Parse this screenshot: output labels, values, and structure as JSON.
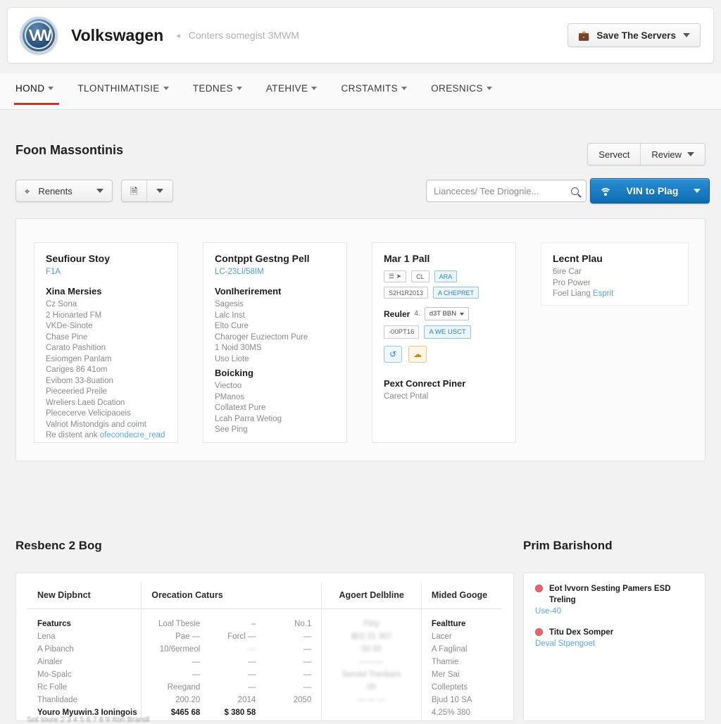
{
  "header": {
    "logo_alt": "vw-logo",
    "brand": "Volkswagen",
    "caret": "◂",
    "subtitle": "Conters somegist 3MWM",
    "save_button": {
      "label": "Save The Servers",
      "icon": "briefcase-icon"
    }
  },
  "nav": {
    "items": [
      {
        "label": "HOND",
        "active": true
      },
      {
        "label": "TLONTHIMATISIE",
        "active": false
      },
      {
        "label": "TEDNES",
        "active": false
      },
      {
        "label": "ATEHIVE",
        "active": false
      },
      {
        "label": "CRSTAMITS",
        "active": false
      },
      {
        "label": "ORESNICS",
        "active": false
      }
    ]
  },
  "section": {
    "title": "Foon Massontinis",
    "segmented": [
      {
        "label": "Servect"
      },
      {
        "label": "Review"
      }
    ]
  },
  "toolbar": {
    "renents_button": {
      "label": "Renents",
      "icon": "filter-icon"
    },
    "view_split": {
      "icon": "book-icon"
    },
    "search": {
      "placeholder": "Lianceces/ Tee Driognie...",
      "value": "",
      "icon": "search-icon"
    },
    "vin_button": {
      "label": "VIN to Plag",
      "icon": "wifi-icon",
      "color": "#0d6cb0"
    }
  },
  "cards": [
    {
      "title": "Seufiour Stoy",
      "link": "F1A",
      "sub": "Xina Mersies",
      "items": [
        "Cz Sona",
        "2 Hionarted FM",
        "VKDe-Sinote",
        "Chase Pine",
        "Carato Pashition",
        "Esiomgen Panlam",
        "Cariges 86 41om",
        "Evibom 33-8uation",
        "Pieceeried Preile",
        "Wreliers Laeti Dcation",
        "Plececerve Velicipaoeis",
        "Valriot Mistondgis and coimt"
      ],
      "last_line_prefix": "Re distent ank ",
      "last_line_link": "ofecondecre_read"
    },
    {
      "title": "Contppt Gestng Pell",
      "link": "LC-23LI/58IM",
      "sub": "VonIherirement",
      "items": [
        "Sagesis",
        "Lalc Inst",
        "Elto Cure",
        "Charoger Euziectom Pure",
        "1 Noid 30MS",
        "Uso Liote"
      ],
      "sub2": "Boicking",
      "items2": [
        "Viectoo",
        "PManos",
        "Collatext Pure",
        "Lcah Parra Wetiog",
        "See Ping"
      ]
    },
    {
      "title": "Mar 1 Pall",
      "chip_row_1": [
        {
          "label": "☰ ➤",
          "style": "plain"
        },
        {
          "label": "CL",
          "style": "plain"
        },
        {
          "label": "ARA",
          "style": "blue"
        }
      ],
      "chip_row_2": [
        {
          "label": "S2H1R2013",
          "style": "plain"
        },
        {
          "label": "A CHEPRET",
          "style": "blue"
        }
      ],
      "reuler_label": "Reuler",
      "reuler_num": "4.",
      "reuler_select": "d3T BBN",
      "chip_row_3": [
        {
          "label": "-00PT16",
          "style": "plain"
        },
        {
          "label": "A WE USCT",
          "style": "blue"
        }
      ],
      "icon_buttons": [
        {
          "icon": "refresh-icon",
          "glyph": "↺",
          "style": "blue"
        },
        {
          "icon": "cloud-icon",
          "glyph": "☁",
          "style": "amber"
        }
      ],
      "sub": "Pext Conrect Piner",
      "sub_note": "Carect Pntal"
    },
    {
      "title": "Lecnt Plau",
      "items": [
        "6ire Car",
        "Pro Power"
      ],
      "last_line_prefix": "Foel Liang ",
      "last_line_link": "Esprit"
    }
  ],
  "bottom": {
    "title": "Resbenc 2 Bog",
    "table": {
      "columns": [
        "New Dipbnct",
        "Orecation Caturs",
        "Agoert Delbline",
        "Mided Googe"
      ],
      "col1": {
        "head": "Featurcs",
        "lines": [
          "Lena",
          "A Pibanch",
          "Ainaler",
          "Mo-Spalc",
          "Rc Folle",
          "Thanlidade"
        ],
        "total": "Youro Myuwin.3 Ioningois"
      },
      "col2": {
        "rows": [
          {
            "a": "Loal Tbesie",
            "b": "–",
            "c": "No.1"
          },
          {
            "a": "Pae —",
            "b": "Forcl —",
            "c": "—"
          },
          {
            "a": "10/6ermeol",
            "b": "—",
            "c": "—"
          },
          {
            "a": "—",
            "b": "—",
            "c": "—"
          },
          {
            "a": "—",
            "b": "—",
            "c": "—"
          },
          {
            "a": "Reegand",
            "b": "—",
            "c": "—"
          },
          {
            "a": "200.20",
            "b": "2014",
            "c": "2050"
          }
        ],
        "total_a": "$465 68",
        "total_b": "$ 380 58"
      },
      "col3": {
        "lines": [
          "Flrty",
          "$02.31 307",
          "00 00",
          "Serviel Trenbars"
        ]
      },
      "col4": {
        "head": "Fealtture",
        "lines": [
          "Lacer",
          "A Faglinal",
          "Thamie",
          "Mer Sai",
          "Colleptets",
          "Bjud 10 SA",
          "4,25% 380"
        ]
      }
    }
  },
  "right_panel": {
    "title": "Prim Barishond",
    "alerts": [
      {
        "icon": "alert-dot",
        "title": "Eot lvvorn Sesting Pamers ESD Treling",
        "link": "Use-40"
      },
      {
        "icon": "alert-dot",
        "title": "Titu Dex Somper",
        "link": "Deval Stpengoet"
      }
    ]
  },
  "footer": {
    "text": "Sot Ioure 2 3 4 5 6 7 8 9 Iton Brandl"
  }
}
